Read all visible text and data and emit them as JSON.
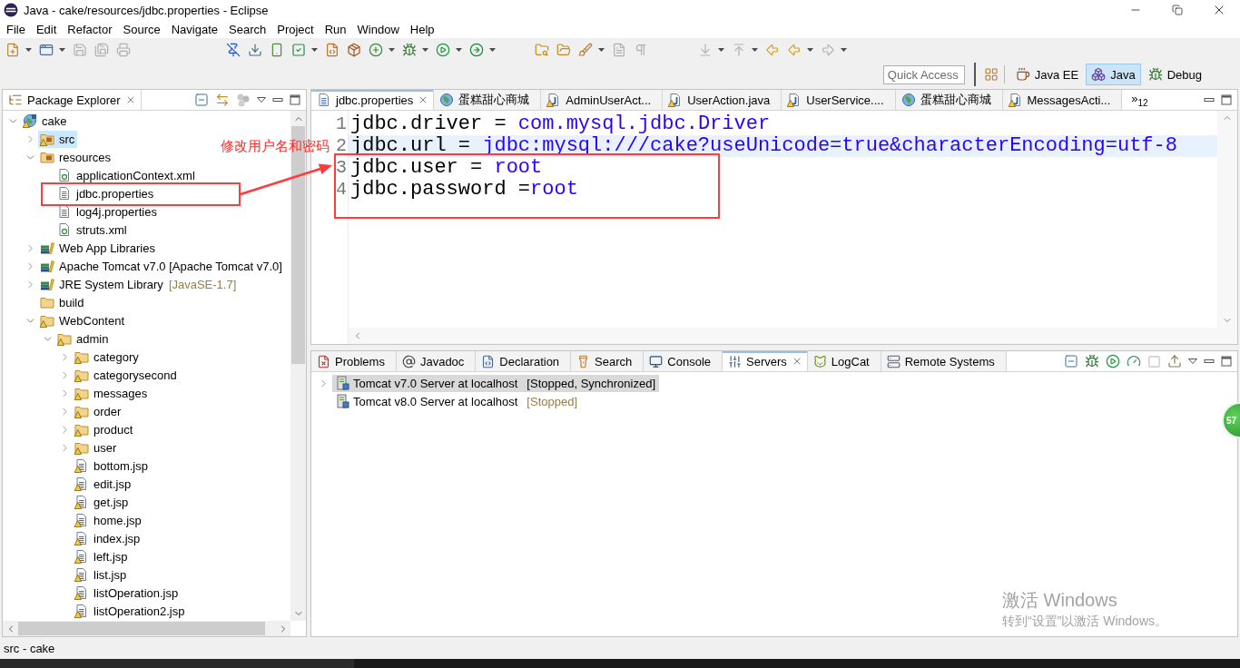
{
  "window": {
    "title": "Java - cake/resources/jdbc.properties - Eclipse"
  },
  "menu": [
    "File",
    "Edit",
    "Refactor",
    "Source",
    "Navigate",
    "Search",
    "Project",
    "Run",
    "Window",
    "Help"
  ],
  "toolbar": {
    "groups": [
      [
        {
          "kind": "new",
          "dropdown": true,
          "disabled": false
        },
        {
          "kind": "new-window",
          "dropdown": true,
          "disabled": false
        },
        {
          "kind": "save",
          "dropdown": false,
          "disabled": true
        },
        {
          "kind": "save-all",
          "dropdown": false,
          "disabled": true
        },
        {
          "kind": "print",
          "dropdown": false,
          "disabled": true
        }
      ],
      [
        {
          "kind": "skip-breakpoints",
          "dropdown": false,
          "disabled": false
        },
        {
          "kind": "sdk-download",
          "dropdown": false,
          "disabled": false
        },
        {
          "kind": "device",
          "dropdown": false,
          "disabled": false
        },
        {
          "kind": "check",
          "dropdown": true,
          "disabled": false
        },
        {
          "kind": "new-class",
          "dropdown": false,
          "disabled": false
        },
        {
          "kind": "new-package",
          "dropdown": false,
          "disabled": false
        },
        {
          "kind": "new-element",
          "dropdown": true,
          "disabled": false
        },
        {
          "kind": "debug",
          "dropdown": true,
          "disabled": false
        },
        {
          "kind": "run",
          "dropdown": true,
          "disabled": false
        },
        {
          "kind": "run-external",
          "dropdown": true,
          "disabled": false
        }
      ],
      [
        {
          "kind": "open-type",
          "dropdown": false,
          "disabled": false
        },
        {
          "kind": "open-folder",
          "dropdown": false,
          "disabled": false
        },
        {
          "kind": "brush",
          "dropdown": true,
          "disabled": false
        },
        {
          "kind": "document",
          "dropdown": false,
          "disabled": true
        },
        {
          "kind": "pilcrow",
          "dropdown": false,
          "disabled": true
        }
      ],
      [
        {
          "kind": "next-annotation",
          "dropdown": true,
          "disabled": true
        },
        {
          "kind": "previous-annotation",
          "dropdown": true,
          "disabled": true
        },
        {
          "kind": "last-edit",
          "dropdown": false,
          "disabled": false
        },
        {
          "kind": "back",
          "dropdown": true,
          "disabled": false
        },
        {
          "kind": "forward",
          "dropdown": true,
          "disabled": true
        }
      ]
    ]
  },
  "quick_access": {
    "placeholder": "Quick Access"
  },
  "perspectives": [
    {
      "label": "Java EE",
      "kind": "javaee",
      "selected": false
    },
    {
      "label": "Java",
      "kind": "java",
      "selected": true
    },
    {
      "label": "Debug",
      "kind": "debug",
      "selected": false
    }
  ],
  "package_explorer": {
    "title": "Package Explorer",
    "tree": [
      {
        "label": "cake",
        "kind": "project",
        "warning": true,
        "selected": false,
        "expanded": true,
        "children": [
          {
            "label": "src",
            "kind": "source-folder",
            "warning": true,
            "selected": true,
            "expanded": false
          },
          {
            "label": "resources",
            "kind": "source-folder",
            "warning": false,
            "selected": false,
            "expanded": true,
            "children": [
              {
                "label": "applicationContext.xml",
                "kind": "xml",
                "warning": false,
                "selected": false
              },
              {
                "label": "jdbc.properties",
                "kind": "properties",
                "warning": false,
                "selected": false
              },
              {
                "label": "log4j.properties",
                "kind": "properties",
                "warning": false,
                "selected": false
              },
              {
                "label": "struts.xml",
                "kind": "xml",
                "warning": false,
                "selected": false
              }
            ]
          },
          {
            "label": "Web App Libraries",
            "kind": "library",
            "warning": false,
            "selected": false,
            "expanded": false
          },
          {
            "label": "Apache Tomcat v7.0 [Apache Tomcat v7.0]",
            "kind": "library",
            "warning": false,
            "selected": false,
            "expanded": false
          },
          {
            "label": "JRE System Library",
            "decoration": "[JavaSE-1.7]",
            "kind": "library",
            "warning": false,
            "selected": false,
            "expanded": false
          },
          {
            "label": "build",
            "kind": "folder",
            "warning": false,
            "selected": false
          },
          {
            "label": "WebContent",
            "kind": "folder",
            "warning": true,
            "selected": false,
            "expanded": true,
            "children": [
              {
                "label": "admin",
                "kind": "folder",
                "warning": true,
                "selected": false,
                "expanded": true,
                "children": [
                  {
                    "label": "category",
                    "kind": "folder",
                    "warning": true,
                    "selected": false,
                    "expanded": false
                  },
                  {
                    "label": "categorysecond",
                    "kind": "folder",
                    "warning": true,
                    "selected": false,
                    "expanded": false
                  },
                  {
                    "label": "messages",
                    "kind": "folder",
                    "warning": true,
                    "selected": false,
                    "expanded": false
                  },
                  {
                    "label": "order",
                    "kind": "folder",
                    "warning": true,
                    "selected": false,
                    "expanded": false
                  },
                  {
                    "label": "product",
                    "kind": "folder",
                    "warning": true,
                    "selected": false,
                    "expanded": false
                  },
                  {
                    "label": "user",
                    "kind": "folder",
                    "warning": true,
                    "selected": false,
                    "expanded": false
                  },
                  {
                    "label": "bottom.jsp",
                    "kind": "jsp",
                    "warning": true,
                    "selected": false
                  },
                  {
                    "label": "edit.jsp",
                    "kind": "jsp",
                    "warning": true,
                    "selected": false
                  },
                  {
                    "label": "get.jsp",
                    "kind": "jsp",
                    "warning": true,
                    "selected": false
                  },
                  {
                    "label": "home.jsp",
                    "kind": "jsp",
                    "warning": true,
                    "selected": false
                  },
                  {
                    "label": "index.jsp",
                    "kind": "jsp",
                    "warning": true,
                    "selected": false
                  },
                  {
                    "label": "left.jsp",
                    "kind": "jsp",
                    "warning": true,
                    "selected": false
                  },
                  {
                    "label": "list.jsp",
                    "kind": "jsp",
                    "warning": true,
                    "selected": false
                  },
                  {
                    "label": "listOperation.jsp",
                    "kind": "jsp",
                    "warning": true,
                    "selected": false
                  },
                  {
                    "label": "listOperation2.jsp",
                    "kind": "jsp",
                    "warning": true,
                    "selected": false
                  }
                ]
              }
            ]
          }
        ]
      }
    ]
  },
  "editor": {
    "tabs": [
      {
        "label": "jdbc.properties",
        "kind": "properties",
        "warning": false,
        "selected": true
      },
      {
        "label": "蛋糕甜心商城",
        "kind": "web",
        "warning": false,
        "selected": false
      },
      {
        "label": "AdminUserAct...",
        "kind": "java",
        "warning": true,
        "selected": false
      },
      {
        "label": "UserAction.java",
        "kind": "java",
        "warning": true,
        "selected": false
      },
      {
        "label": "UserService....",
        "kind": "java",
        "warning": true,
        "selected": false
      },
      {
        "label": "蛋糕甜心商城",
        "kind": "web",
        "warning": false,
        "selected": false
      },
      {
        "label": "MessagesActi...",
        "kind": "java",
        "warning": true,
        "selected": false
      }
    ],
    "overflow": "»$_{12}$",
    "lines": [
      {
        "number": "1",
        "key": "jdbc.driver",
        "assign": " = ",
        "value": "com.mysql.jdbc.Driver",
        "current": false
      },
      {
        "number": "2",
        "key": "jdbc.url",
        "assign": " = ",
        "value": "jdbc:mysql:///cake?useUnicode=true&characterEncoding=utf-8",
        "current": true
      },
      {
        "number": "3",
        "key": "jdbc.user",
        "assign": " = ",
        "value": "root",
        "current": false
      },
      {
        "number": "4",
        "key": "jdbc.password",
        "assign": " =",
        "value": "root",
        "current": false
      }
    ]
  },
  "bottom_panel": {
    "tabs": [
      {
        "label": "Problems",
        "kind": "problems",
        "selected": false
      },
      {
        "label": "Javadoc",
        "kind": "javadoc",
        "selected": false
      },
      {
        "label": "Declaration",
        "kind": "declaration",
        "selected": false
      },
      {
        "label": "Search",
        "kind": "search",
        "selected": false
      },
      {
        "label": "Console",
        "kind": "console",
        "selected": false
      },
      {
        "label": "Servers",
        "kind": "servers",
        "selected": true
      },
      {
        "label": "LogCat",
        "kind": "logcat",
        "selected": false
      },
      {
        "label": "Remote Systems",
        "kind": "remote-systems",
        "selected": false
      }
    ],
    "servers": [
      {
        "name": "Tomcat v7.0 Server at localhost",
        "status": "[Stopped, Synchronized]",
        "selected": true,
        "expanded": false
      },
      {
        "name": "Tomcat v8.0 Server at localhost",
        "status": "[Stopped]",
        "selected": false
      }
    ]
  },
  "annotation": {
    "text": "修改用户名和密码"
  },
  "status_bar": {
    "text": "src - cake"
  },
  "floating_badge": {
    "text": "57"
  },
  "os_watermark": {
    "title": "激活 Windows",
    "subtitle": "转到“设置”以激活 Windows。"
  }
}
